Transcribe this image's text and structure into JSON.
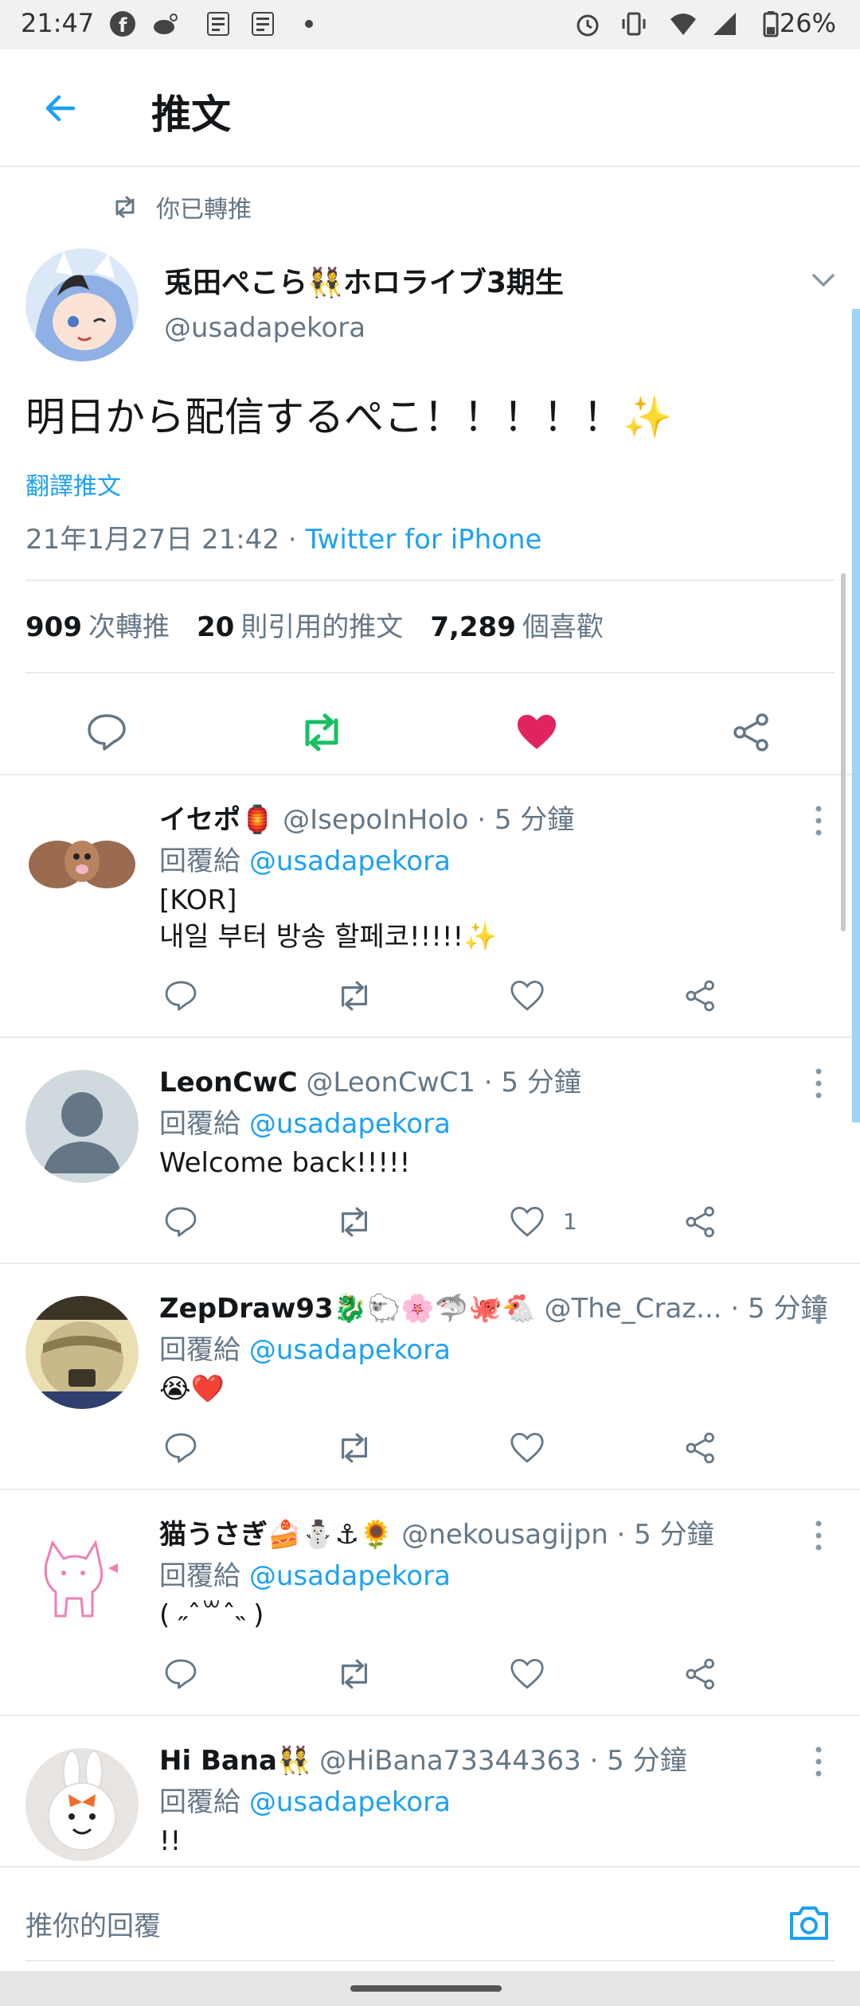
{
  "status_bar": {
    "time": "21:47",
    "battery": "26%"
  },
  "header": {
    "title": "推文"
  },
  "main_tweet": {
    "retweeted_label": "你已轉推",
    "author_name": "兎田ぺこら👯ホロライブ3期生",
    "author_handle": "@usadapekora",
    "text": "明日から配信するぺこ！！！！！✨",
    "translate_label": "翻譯推文",
    "timestamp": "21年1月27日 21:42 · ",
    "source": "Twitter for iPhone",
    "stats": {
      "retweets_count": "909",
      "retweets_label": "次轉推",
      "quotes_count": "20",
      "quotes_label": "則引用的推文",
      "likes_count": "7,289",
      "likes_label": "個喜歡"
    }
  },
  "replies": [
    {
      "name": "イセポ🏮",
      "handle": "@IsepoInHolo",
      "time": " · 5 分鐘",
      "reply_to_label": "回覆給 ",
      "reply_to_handle": "@usadapekora",
      "body_line1": "[KOR]",
      "body_line2": "내일 부터 방송 할페코!!!!!✨",
      "like_count": ""
    },
    {
      "name": "LeonCwC",
      "handle": "@LeonCwC1",
      "time": " · 5 分鐘",
      "reply_to_label": "回覆給 ",
      "reply_to_handle": "@usadapekora",
      "body_line1": "Welcome back!!!!!",
      "body_line2": "",
      "like_count": "1"
    },
    {
      "name": "ZepDraw93🐉🐑🌸🦈🐙🐔",
      "handle": "@The_Craz...",
      "time": " · 5 分鐘",
      "reply_to_label": "回覆給 ",
      "reply_to_handle": "@usadapekora",
      "body_line1": "😭❤️",
      "body_line2": "",
      "like_count": ""
    },
    {
      "name": "猫うさぎ🍰⛄⚓🌻",
      "handle": "@nekousagijpn",
      "time": " · 5 分鐘",
      "reply_to_label": "回覆給 ",
      "reply_to_handle": "@usadapekora",
      "body_line1": "( ˶ˆ꒳ˆ˵ )",
      "body_line2": "",
      "like_count": ""
    },
    {
      "name": "Hi Bana👯",
      "handle": "@HiBana73344363",
      "time": " · 5 分鐘",
      "reply_to_label": "回覆給 ",
      "reply_to_handle": "@usadapekora",
      "body_line1": "!!",
      "body_line2": "",
      "like_count": ""
    }
  ],
  "compose": {
    "placeholder": "推你的回覆"
  },
  "colors": {
    "accent": "#1da1f2",
    "retweet_active": "#17bf63",
    "like_active": "#e0245e"
  }
}
